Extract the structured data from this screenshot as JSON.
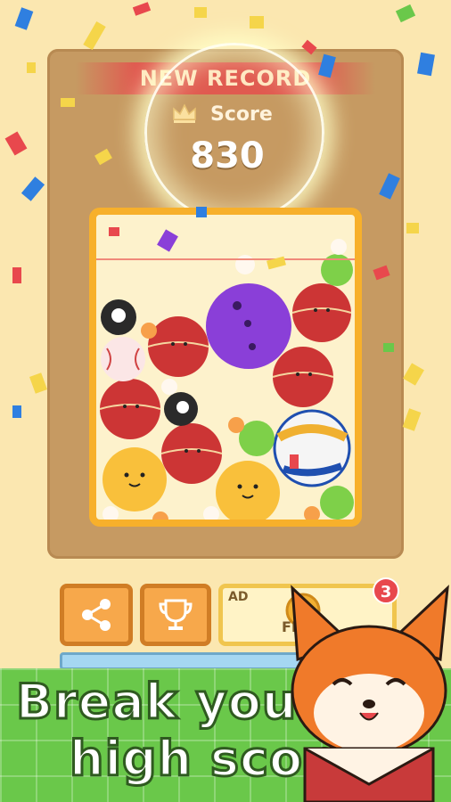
{
  "header": {
    "banner_text": "NEW RECORD",
    "score_label": "Score",
    "score_value": "830"
  },
  "buttons": {
    "share_icon": "share-icon",
    "trophy_icon": "trophy-icon",
    "free_label": "FR",
    "ad_label": "AD",
    "free_badge": "3"
  },
  "promo": {
    "line1": "Break your",
    "line2": "high score!"
  },
  "colors": {
    "background": "#fbe7b0",
    "board": "#c69a62",
    "container_border": "#f7b02b",
    "banner": "#e05a50",
    "button": "#f7a84b",
    "promo_green": "#6ac84a"
  },
  "balls": [
    {
      "name": "cricket-ball"
    },
    {
      "name": "bowling-ball"
    },
    {
      "name": "volleyball"
    },
    {
      "name": "tennis-ball"
    },
    {
      "name": "eight-ball"
    },
    {
      "name": "baseball"
    },
    {
      "name": "smiley-ball"
    },
    {
      "name": "ping-pong-ball"
    }
  ]
}
